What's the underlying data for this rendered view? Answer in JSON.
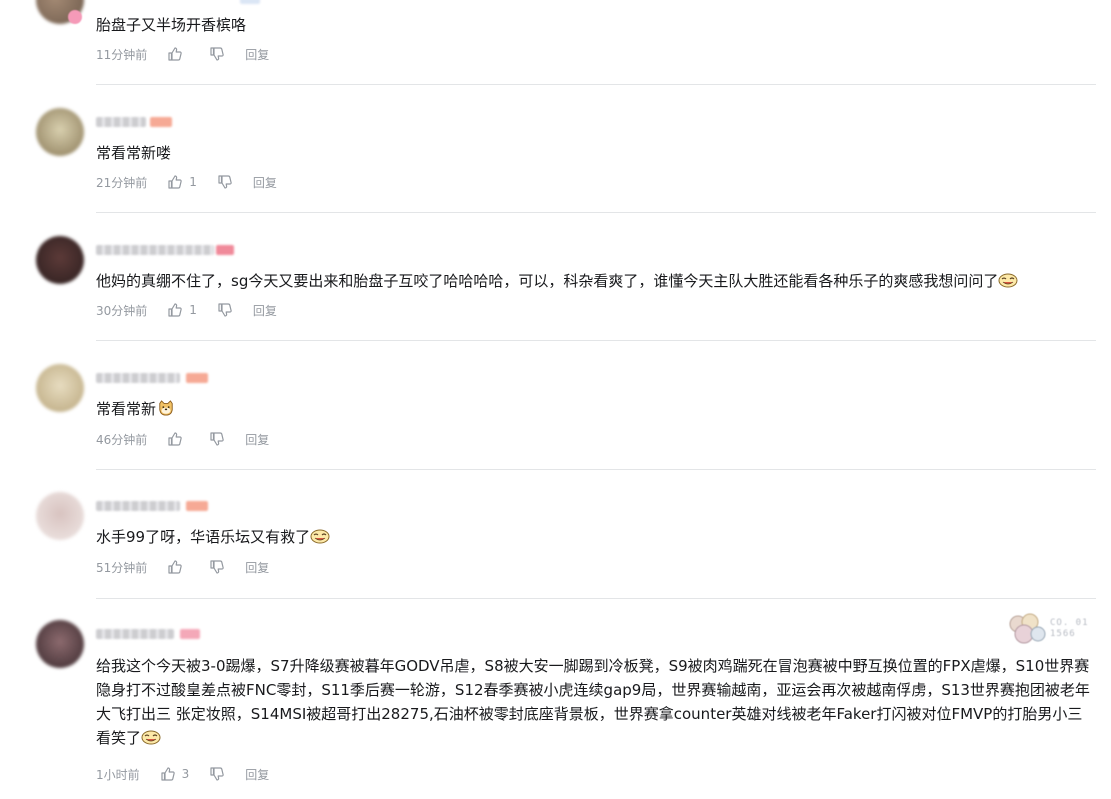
{
  "comments": [
    {
      "text": "胎盘子又半场开香槟咯",
      "time": "11分钟前",
      "likes": "",
      "reply": "回复",
      "avatar_colors": [
        "#6d5a4b",
        "#a48a74"
      ]
    },
    {
      "text": "常看常新喽",
      "time": "21分钟前",
      "likes": "1",
      "reply": "回复",
      "avatar_colors": [
        "#8a7a58",
        "#d8cfae"
      ]
    },
    {
      "text": "他妈的真绷不住了，sg今天又要出来和胎盘子互咬了哈哈哈哈，可以，科杂看爽了，谁懂今天主队大胜还能看各种乐子的爽感我想问问了",
      "time": "30分钟前",
      "likes": "1",
      "reply": "回复",
      "avatar_colors": [
        "#2b1e1e",
        "#5c3a38"
      ]
    },
    {
      "text": "常看常新",
      "time": "46分钟前",
      "likes": "",
      "reply": "回复",
      "avatar_colors": [
        "#b9a67c",
        "#e7dcc0"
      ]
    },
    {
      "text": "水手99了呀，华语乐坛又有救了",
      "time": "51分钟前",
      "likes": "",
      "reply": "回复",
      "avatar_colors": [
        "#f0e8e6",
        "#d8c3c0"
      ]
    },
    {
      "text": "给我这个今天被3-0踢爆，S7升降级赛被暮年GODV吊虐，S8被大安一脚踢到冷板凳，S9被肉鸡踹死在冒泡赛被中野互换位置的FPX虐爆，S10世界赛隐身打不过酸皇差点被FNC零封，S11季后赛一轮游，S12春季赛被小虎连续gap9局，世界赛输越南，亚运会再次被越南俘虏，S13世界赛抱团被老年大飞打出三 张定妆照，S14MSI被超哥打出28275,石油杯被零封底座背景板，世界赛拿counter英雄对线被老年Faker打闪被对位FMVP的打胎男小三看笑了",
      "time": "1小时前",
      "likes": "3",
      "reply": "回复",
      "avatar_colors": [
        "#3a2a2e",
        "#8c6a6e"
      ]
    }
  ],
  "badge_text": "CO. 011566"
}
